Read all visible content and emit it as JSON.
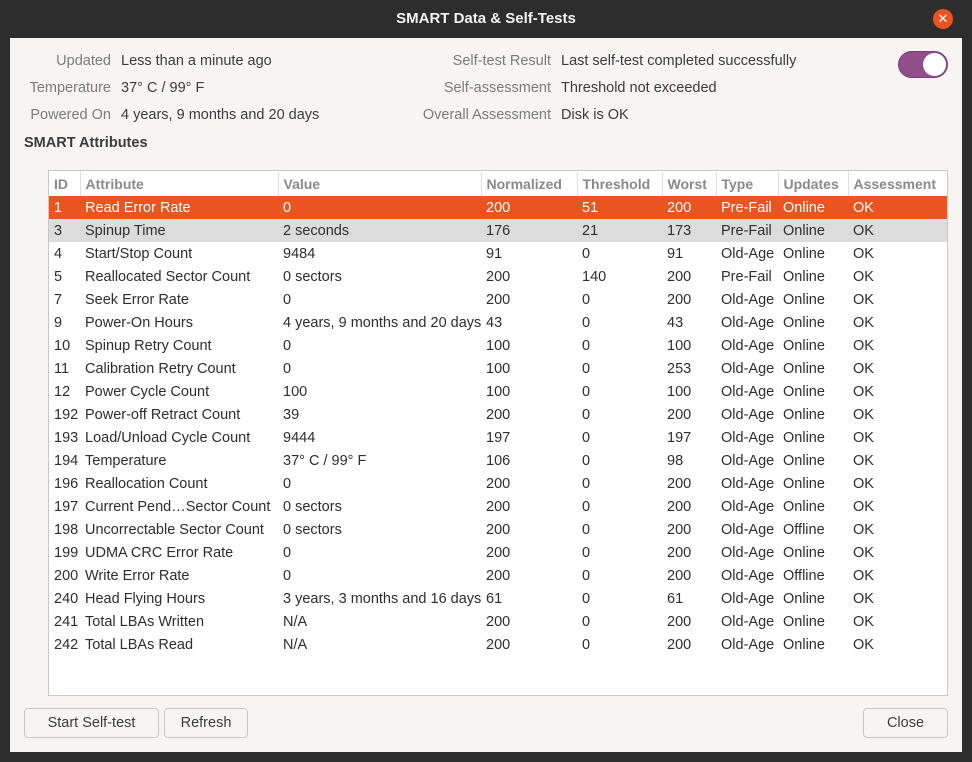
{
  "window": {
    "title": "SMART Data & Self-Tests"
  },
  "info": {
    "updated_label": "Updated",
    "updated_value": "Less than a minute ago",
    "temperature_label": "Temperature",
    "temperature_value": "37° C / 99° F",
    "powered_on_label": "Powered On",
    "powered_on_value": "4 years, 9 months and 20 days",
    "selftest_result_label": "Self-test Result",
    "selftest_result_value": "Last self-test completed successfully",
    "self_assessment_label": "Self-assessment",
    "self_assessment_value": "Threshold not exceeded",
    "overall_assessment_label": "Overall Assessment",
    "overall_assessment_value": "Disk is OK"
  },
  "toggle": {
    "state": "on"
  },
  "smart": {
    "title": "SMART Attributes",
    "columns": [
      "ID",
      "Attribute",
      "Value",
      "Normalized",
      "Threshold",
      "Worst",
      "Type",
      "Updates",
      "Assessment"
    ],
    "rows": [
      [
        "1",
        "Read Error Rate",
        "0",
        "200",
        "51",
        "200",
        "Pre-Fail",
        "Online",
        "OK"
      ],
      [
        "3",
        "Spinup Time",
        "2 seconds",
        "176",
        "21",
        "173",
        "Pre-Fail",
        "Online",
        "OK"
      ],
      [
        "4",
        "Start/Stop Count",
        "9484",
        "91",
        "0",
        "91",
        "Old-Age",
        "Online",
        "OK"
      ],
      [
        "5",
        "Reallocated Sector Count",
        "0 sectors",
        "200",
        "140",
        "200",
        "Pre-Fail",
        "Online",
        "OK"
      ],
      [
        "7",
        "Seek Error Rate",
        "0",
        "200",
        "0",
        "200",
        "Old-Age",
        "Online",
        "OK"
      ],
      [
        "9",
        "Power-On Hours",
        "4 years, 9 months and 20 days",
        "43",
        "0",
        "43",
        "Old-Age",
        "Online",
        "OK"
      ],
      [
        "10",
        "Spinup Retry Count",
        "0",
        "100",
        "0",
        "100",
        "Old-Age",
        "Online",
        "OK"
      ],
      [
        "11",
        "Calibration Retry Count",
        "0",
        "100",
        "0",
        "253",
        "Old-Age",
        "Online",
        "OK"
      ],
      [
        "12",
        "Power Cycle Count",
        "100",
        "100",
        "0",
        "100",
        "Old-Age",
        "Online",
        "OK"
      ],
      [
        "192",
        "Power-off Retract Count",
        "39",
        "200",
        "0",
        "200",
        "Old-Age",
        "Online",
        "OK"
      ],
      [
        "193",
        "Load/Unload Cycle Count",
        "9444",
        "197",
        "0",
        "197",
        "Old-Age",
        "Online",
        "OK"
      ],
      [
        "194",
        "Temperature",
        "37° C / 99° F",
        "106",
        "0",
        "98",
        "Old-Age",
        "Online",
        "OK"
      ],
      [
        "196",
        "Reallocation Count",
        "0",
        "200",
        "0",
        "200",
        "Old-Age",
        "Online",
        "OK"
      ],
      [
        "197",
        "Current Pend…Sector Count",
        "0 sectors",
        "200",
        "0",
        "200",
        "Old-Age",
        "Online",
        "OK"
      ],
      [
        "198",
        "Uncorrectable Sector Count",
        "0 sectors",
        "200",
        "0",
        "200",
        "Old-Age",
        "Offline",
        "OK"
      ],
      [
        "199",
        "UDMA CRC Error Rate",
        "0",
        "200",
        "0",
        "200",
        "Old-Age",
        "Online",
        "OK"
      ],
      [
        "200",
        "Write Error Rate",
        "0",
        "200",
        "0",
        "200",
        "Old-Age",
        "Offline",
        "OK"
      ],
      [
        "240",
        "Head Flying Hours",
        "3 years, 3 months and 16 days",
        "61",
        "0",
        "61",
        "Old-Age",
        "Online",
        "OK"
      ],
      [
        "241",
        "Total LBAs Written",
        "N/A",
        "200",
        "0",
        "200",
        "Old-Age",
        "Online",
        "OK"
      ],
      [
        "242",
        "Total LBAs Read",
        "N/A",
        "200",
        "0",
        "200",
        "Old-Age",
        "Online",
        "OK"
      ]
    ]
  },
  "buttons": {
    "start_selftest": "Start Self-test",
    "refresh": "Refresh",
    "close": "Close"
  },
  "colors": {
    "selected_row": "#e95420",
    "hover_row": "#dcdcdc",
    "toggle_on": "#924d8b"
  }
}
